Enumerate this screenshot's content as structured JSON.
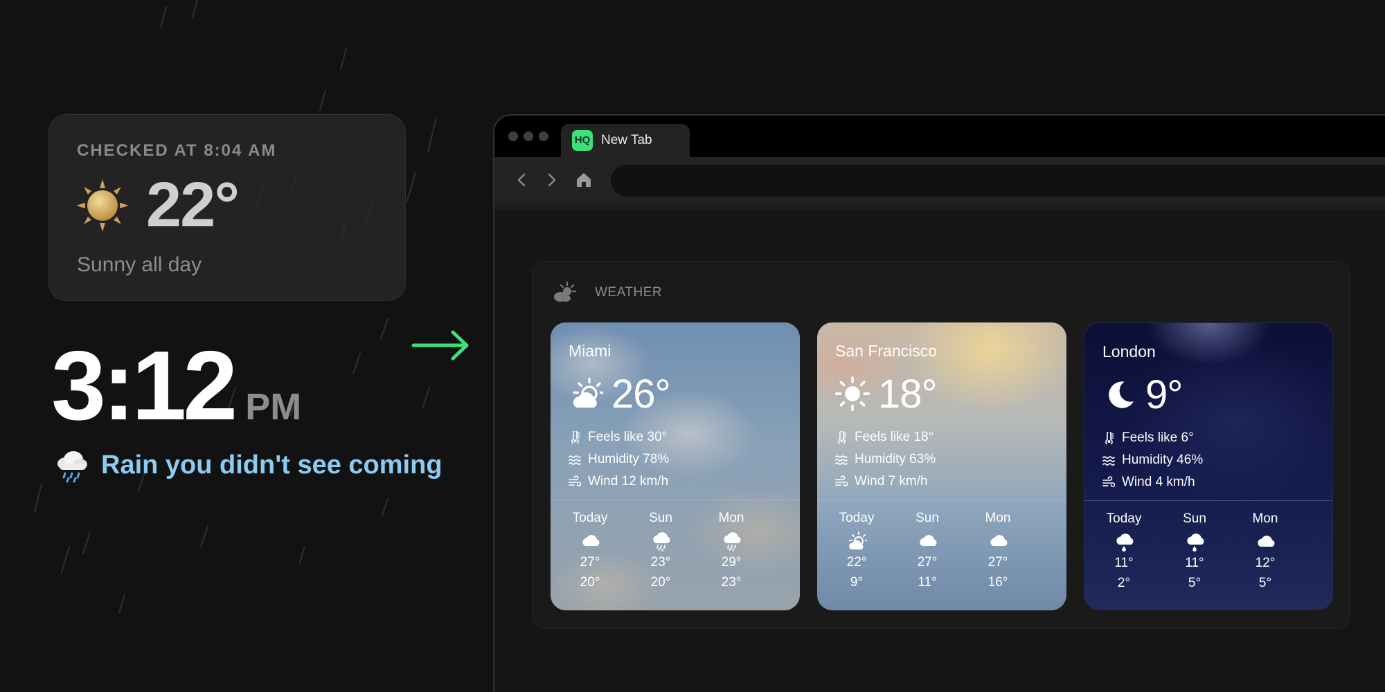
{
  "promo": {
    "old_card": {
      "checked_label": "CHECKED AT 8:04 AM",
      "temp": "22°",
      "condition": "Sunny all day",
      "icon": "sun-icon"
    },
    "clock": {
      "time": "3:12",
      "ampm": "PM"
    },
    "rain_message": "Rain you didn't see coming",
    "rain_icon": "rain-cloud-icon",
    "arrow_color": "#3ee07a"
  },
  "browser": {
    "tab": {
      "favicon_text": "HQ",
      "title": "New Tab"
    },
    "toolbar": {
      "back_icon": "chevron-left-icon",
      "forward_icon": "chevron-right-icon",
      "home_icon": "home-icon"
    },
    "weather": {
      "title": "WEATHER",
      "cities": [
        {
          "name": "Miami",
          "temp": "26°",
          "icon": "partly-sunny-icon",
          "feels": "Feels like 30°",
          "humidity": "Humidity 78%",
          "wind": "Wind 12 km/h",
          "forecast": [
            {
              "day": "Today",
              "icon": "cloud-icon",
              "hi": "27°",
              "lo": "20°"
            },
            {
              "day": "Sun",
              "icon": "rain-cloud-icon",
              "hi": "23°",
              "lo": "20°"
            },
            {
              "day": "Mon",
              "icon": "rain-cloud-icon",
              "hi": "29°",
              "lo": "23°"
            }
          ]
        },
        {
          "name": "San Francisco",
          "temp": "18°",
          "icon": "sun-icon",
          "feels": "Feels like 18°",
          "humidity": "Humidity 63%",
          "wind": "Wind 7 km/h",
          "forecast": [
            {
              "day": "Today",
              "icon": "partly-sunny-icon",
              "hi": "22°",
              "lo": "9°"
            },
            {
              "day": "Sun",
              "icon": "cloud-icon",
              "hi": "27°",
              "lo": "11°"
            },
            {
              "day": "Mon",
              "icon": "cloud-icon",
              "hi": "27°",
              "lo": "16°"
            }
          ]
        },
        {
          "name": "London",
          "temp": "9°",
          "icon": "moon-icon",
          "feels": "Feels like 6°",
          "humidity": "Humidity 46%",
          "wind": "Wind 4 km/h",
          "forecast": [
            {
              "day": "Today",
              "icon": "drizzle-cloud-icon",
              "hi": "11°",
              "lo": "2°"
            },
            {
              "day": "Sun",
              "icon": "drizzle-cloud-icon",
              "hi": "11°",
              "lo": "5°"
            },
            {
              "day": "Mon",
              "icon": "cloud-icon",
              "hi": "12°",
              "lo": "5°"
            }
          ]
        }
      ]
    }
  }
}
